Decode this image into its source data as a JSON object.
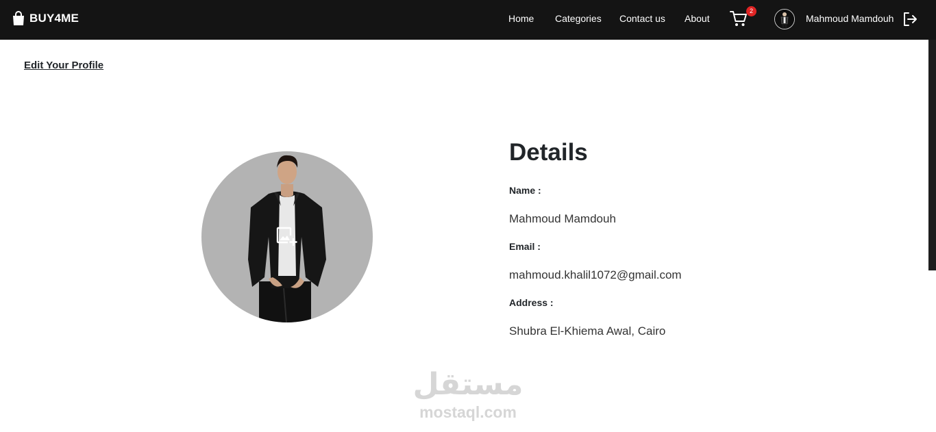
{
  "navbar": {
    "brand": "BUY4ME",
    "links": [
      "Home",
      "Categories",
      "Contact us",
      "About"
    ],
    "cart_count": "2",
    "username": "Mahmoud Mamdouh"
  },
  "page": {
    "edit_link": "Edit Your Profile"
  },
  "details": {
    "title": "Details",
    "name_label": "Name :",
    "name_value": "Mahmoud Mamdouh",
    "email_label": "Email :",
    "email_value": "mahmoud.khalil1072@gmail.com",
    "address_label": "Address :",
    "address_value": "Shubra El-Khiema Awal, Cairo"
  },
  "watermark": {
    "arabic": "مستقل",
    "latin": "mostaql.com"
  },
  "colors": {
    "navbar_bg": "#141414",
    "badge": "#e02424",
    "photo_bg": "#b3b3b3"
  },
  "icons": [
    "shopping-bag-icon",
    "cart-icon",
    "logout-icon",
    "add-photo-icon"
  ]
}
